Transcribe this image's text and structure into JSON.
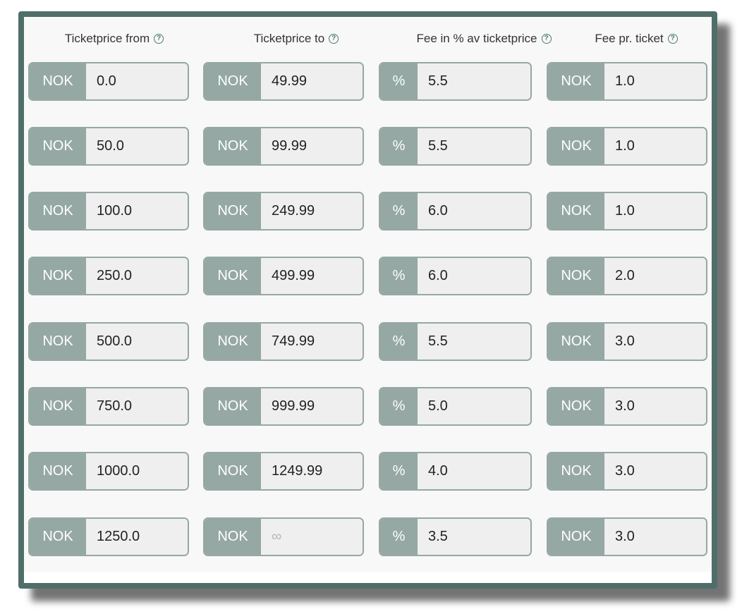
{
  "headers": [
    "Ticketprice from",
    "Ticketprice to",
    "Fee in % av ticketprice",
    "Fee pr. ticket"
  ],
  "help_glyph": "?",
  "prefixes": {
    "currency": "NOK",
    "percent": "%"
  },
  "rows": [
    {
      "from": "0.0",
      "to": "49.99",
      "fee_percent": "5.5",
      "fee_per_ticket": "1.0"
    },
    {
      "from": "50.0",
      "to": "99.99",
      "fee_percent": "5.5",
      "fee_per_ticket": "1.0"
    },
    {
      "from": "100.0",
      "to": "249.99",
      "fee_percent": "6.0",
      "fee_per_ticket": "1.0"
    },
    {
      "from": "250.0",
      "to": "499.99",
      "fee_percent": "6.0",
      "fee_per_ticket": "2.0"
    },
    {
      "from": "500.0",
      "to": "749.99",
      "fee_percent": "5.5",
      "fee_per_ticket": "3.0"
    },
    {
      "from": "750.0",
      "to": "999.99",
      "fee_percent": "5.0",
      "fee_per_ticket": "3.0"
    },
    {
      "from": "1000.0",
      "to": "1249.99",
      "fee_percent": "4.0",
      "fee_per_ticket": "3.0"
    },
    {
      "from": "1250.0",
      "to": "",
      "to_placeholder": "∞",
      "fee_percent": "3.5",
      "fee_per_ticket": "3.0"
    }
  ],
  "colors": {
    "frame_border": "#4f6e69",
    "addon_background": "#95a8a4",
    "input_background": "#efefef",
    "help_icon": "#4f7a66"
  }
}
